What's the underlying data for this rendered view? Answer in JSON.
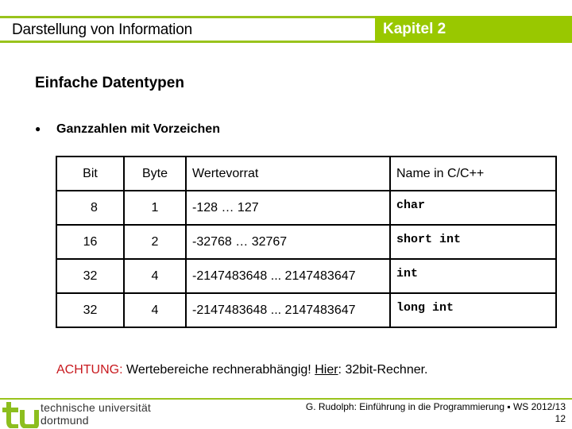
{
  "header": {
    "title": "Darstellung von Information",
    "chapter": "Kapitel 2",
    "accent_color": "#99c800"
  },
  "section": {
    "title": "Einfache Datentypen",
    "bullet": "Ganzzahlen mit Vorzeichen"
  },
  "table": {
    "headers": [
      "Bit",
      "Byte",
      "Wertevorrat",
      "Name in C/C++"
    ],
    "rows": [
      [
        "8",
        "1",
        "-128 … 127",
        "char"
      ],
      [
        "16",
        "2",
        "-32768 … 32767",
        "short int"
      ],
      [
        "32",
        "4",
        "-2147483648 ... 2147483647",
        "int"
      ],
      [
        "32",
        "4",
        "-2147483648 ... 2147483647",
        "long int"
      ]
    ]
  },
  "warning": {
    "label": "ACHTUNG",
    "colon": ":",
    "text": " Wertebereiche rechnerabhängig! ",
    "hier": "Hier",
    "rest": ": 32bit-Rechner.",
    "label_color": "#c8191e"
  },
  "footer": {
    "university_line1": "technische universität",
    "university_line2": "dortmund",
    "credit": "G. Rudolph: Einführung in die Programmierung ▪ WS 2012/13",
    "page_number": "12"
  }
}
